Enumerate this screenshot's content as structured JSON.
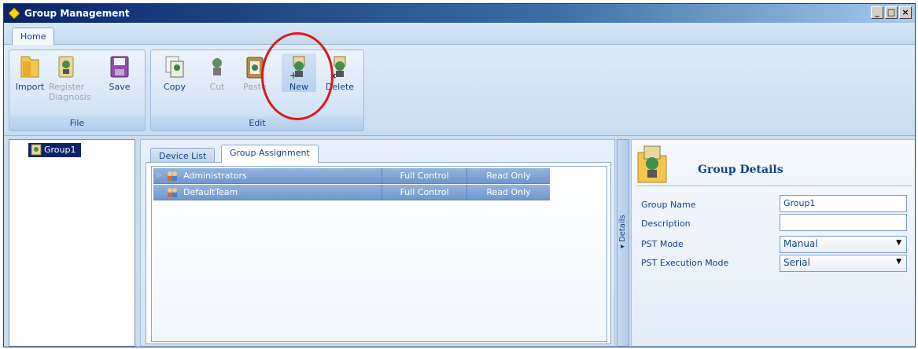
{
  "window": {
    "title": "Group Management",
    "controls": {
      "minimize": "_",
      "maximize": "□",
      "close": "×"
    }
  },
  "ribbon": {
    "tabs": [
      {
        "label": "Home"
      }
    ],
    "groups": [
      {
        "label": "File",
        "buttons": [
          {
            "label": "Import",
            "icon": "folder-icon",
            "enabled": true
          },
          {
            "label": "Register Diagnosis",
            "icon": "register-diagnosis-icon",
            "enabled": false
          },
          {
            "label": "Save",
            "icon": "save-disk-icon",
            "enabled": true
          }
        ]
      },
      {
        "label": "Edit",
        "buttons": [
          {
            "label": "Copy",
            "icon": "copy-icon",
            "enabled": true
          },
          {
            "label": "Cut",
            "icon": "cut-icon",
            "enabled": false
          },
          {
            "label": "Paste",
            "icon": "paste-icon",
            "enabled": false
          },
          {
            "label": "New",
            "icon": "new-valve-icon",
            "enabled": true,
            "highlighted": true
          },
          {
            "label": "Delete",
            "icon": "delete-valve-icon",
            "enabled": true
          }
        ]
      }
    ]
  },
  "tree": {
    "items": [
      {
        "label": "Group1",
        "icon": "group-device-icon",
        "selected": true
      }
    ]
  },
  "center": {
    "tabs": [
      {
        "label": "Device List",
        "active": false
      },
      {
        "label": "Group Assignment",
        "active": true
      }
    ],
    "rows": [
      {
        "name": "Administrators",
        "expandable": true,
        "control": "Full Control",
        "access": "Read Only",
        "icon": "users-group-icon"
      },
      {
        "name": "DefaultTeam",
        "expandable": false,
        "control": "Full Control",
        "access": "Read Only",
        "icon": "users-group-icon"
      }
    ]
  },
  "splitter": {
    "label": "◂Details"
  },
  "details": {
    "title": "Group Details",
    "icon": "group-folder-icon",
    "fields": {
      "group_name": {
        "label": "Group Name",
        "value": "Group1"
      },
      "description": {
        "label": "Description",
        "value": ""
      },
      "pst_mode": {
        "label": "PST Mode",
        "value": "Manual"
      },
      "pst_execution_mode": {
        "label": "PST Execution Mode",
        "value": "Serial"
      }
    }
  },
  "colors": {
    "title_bar": "#0a246a",
    "ribbon_bg": "#dfeaf6",
    "row_bg": "#6f98cf",
    "accent_text": "#15428b",
    "annotation_circle": "#e0161b"
  }
}
